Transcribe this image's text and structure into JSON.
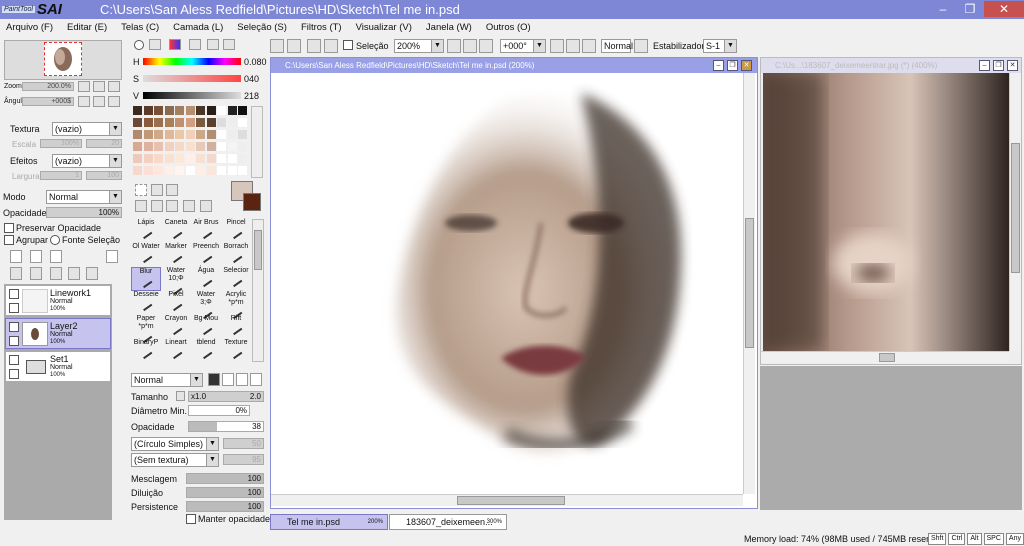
{
  "app": {
    "logo_small": "PaintTool",
    "logo_big": "SAI",
    "title": "C:\\Users\\San Aless Redfield\\Pictures\\HD\\Sketch\\Tel me in.psd"
  },
  "menu": [
    "Arquivo (F)",
    "Editar (E)",
    "Telas (C)",
    "Camada (L)",
    "Seleção (S)",
    "Filtros (T)",
    "Visualizar (V)",
    "Janela (W)",
    "Outros (O)"
  ],
  "toolbar": {
    "selection_label": "Seleção",
    "zoom": "200%",
    "angle": "+000°",
    "mode": "Normal",
    "stabilizer_label": "Estabilizador",
    "stabilizer_value": "S-1"
  },
  "navigator": {
    "zoom_label": "Zoom",
    "zoom_value": "200.0%",
    "angle_label": "Ângulo",
    "angle_value": "+000$"
  },
  "left": {
    "texture_label": "Textura",
    "texture_value": "(vazio)",
    "scale_label": "Escala",
    "scale_value": "100%",
    "scale_num": "20",
    "effects_label": "Efeitos",
    "effects_value": "(vazio)",
    "width_label": "Largura",
    "width_value": "1",
    "width_num": "100",
    "mode_label": "Modo",
    "mode_value": "Normal",
    "opacity_label": "Opacidade",
    "opacity_value": "100%",
    "preserve_opacity": "Preservar Opacidade",
    "group": "Agrupar",
    "selection_source": "Fonte Seleção"
  },
  "layers": [
    {
      "name": "Linework1",
      "mode": "Normal",
      "opacity": "100%"
    },
    {
      "name": "Layer2",
      "mode": "Normal",
      "opacity": "100%"
    },
    {
      "name": "Set1",
      "mode": "Normal",
      "opacity": "100%"
    }
  ],
  "color": {
    "h_label": "H",
    "h_value": "0.080",
    "s_label": "S",
    "s_value": "040",
    "v_label": "V",
    "v_value": "218",
    "primary": "#d7c6bc",
    "secondary": "#5a2410"
  },
  "tools": [
    "Lápis",
    "Caneta",
    "Air Brus",
    "Pincel",
    "Ol Water",
    "Marker",
    "Preench",
    "Borrach",
    "Blur",
    "Water 10;Φ",
    "Água",
    "Selecior",
    "Desseie",
    "Pixel",
    "Water 3;Φ",
    "Acrylic *p*m",
    "Paper *p*m",
    "Crayon",
    "Bg Mou",
    "Rift",
    "BinaryP",
    "Lineart",
    "tblend",
    "Texture"
  ],
  "brush": {
    "blend": "Normal",
    "size_label": "Tamanho",
    "size_mult": "x1.0",
    "size_value": "2.0",
    "min_diam_label": "Diâmetro Min.",
    "min_diam_value": "0%",
    "opacity_label": "Opacidade",
    "opacity_value": "38",
    "shape": "(Círculo Simples)",
    "shape_val": "50",
    "texture": "(Sem textura)",
    "texture_val": "95",
    "mix_label": "Mesclagem",
    "mix_value": "100",
    "dilution_label": "Diluição",
    "dilution_value": "100",
    "persistence_label": "Persistence",
    "persistence_value": "100",
    "keep_opacity": "Manter opacidade"
  },
  "canvas_windows": [
    {
      "title": "C:\\Users\\San Aless Redfield\\Pictures\\HD\\Sketch\\Tel me in.psd (200%)"
    },
    {
      "title": "C:\\Us...\\183607_deixemeentrar.jpg (*) (400%)"
    }
  ],
  "tabs": [
    {
      "name": "Tel me in.psd",
      "zoom": "200%"
    },
    {
      "name": "183607_deixemeen...",
      "zoom": "300%"
    }
  ],
  "status": {
    "memory": "Memory load: 74% (98MB used / 745MB reserved)",
    "keys": [
      "Shft",
      "Ctrl",
      "Alt",
      "SPC",
      "Any"
    ]
  },
  "colors": {
    "titlebar": "#7e86d6",
    "selected_layer": "#c7c3ef",
    "canvas_title": "#9aa0e6"
  }
}
